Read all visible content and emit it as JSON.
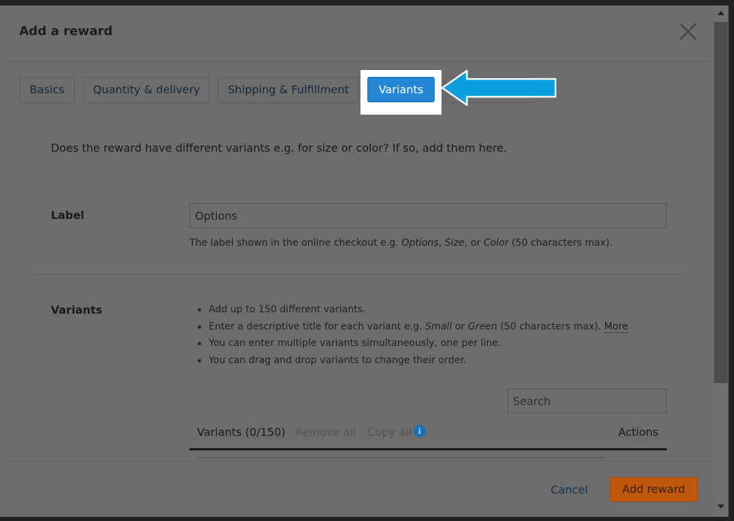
{
  "modal": {
    "title": "Add a reward"
  },
  "tabs": [
    {
      "label": "Basics"
    },
    {
      "label": "Quantity & delivery"
    },
    {
      "label": "Shipping & Fulfillment"
    },
    {
      "label": "Variants"
    }
  ],
  "intro": "Does the reward have different variants e.g. for size or color? If so, add them here.",
  "label_field": {
    "label": "Label",
    "value": "Options",
    "help_prefix": "The label shown in the online checkout e.g. ",
    "help_ex1": "Options",
    "help_sep1": ", ",
    "help_ex2": "Size",
    "help_sep2": ", or ",
    "help_ex3": "Color",
    "help_suffix": " (50 characters max)."
  },
  "variants_section": {
    "label": "Variants",
    "bullet1": "Add up to 150 different variants.",
    "bullet2_prefix": "Enter a descriptive title for each variant e.g. ",
    "bullet2_ex1": "Small",
    "bullet2_mid": " or ",
    "bullet2_ex2": "Green",
    "bullet2_suffix": " (50 characters max). ",
    "more_link": "More",
    "bullet3": "You can enter multiple variants simultaneously, one per line.",
    "bullet4": "You can drag and drop variants to change their order.",
    "search_placeholder": "Search",
    "list_title": "Variants (0/150)",
    "separator": "·",
    "remove_all": "Remove all",
    "copy_all": "Copy all",
    "info_icon_glyph": "i",
    "actions": "Actions"
  },
  "footer": {
    "cancel_label": "Cancel",
    "add_label": "Add reward"
  },
  "colors": {
    "active_tab": "#2385d3",
    "arrow": "#0aa0df",
    "primary_button": "#c1560d"
  }
}
